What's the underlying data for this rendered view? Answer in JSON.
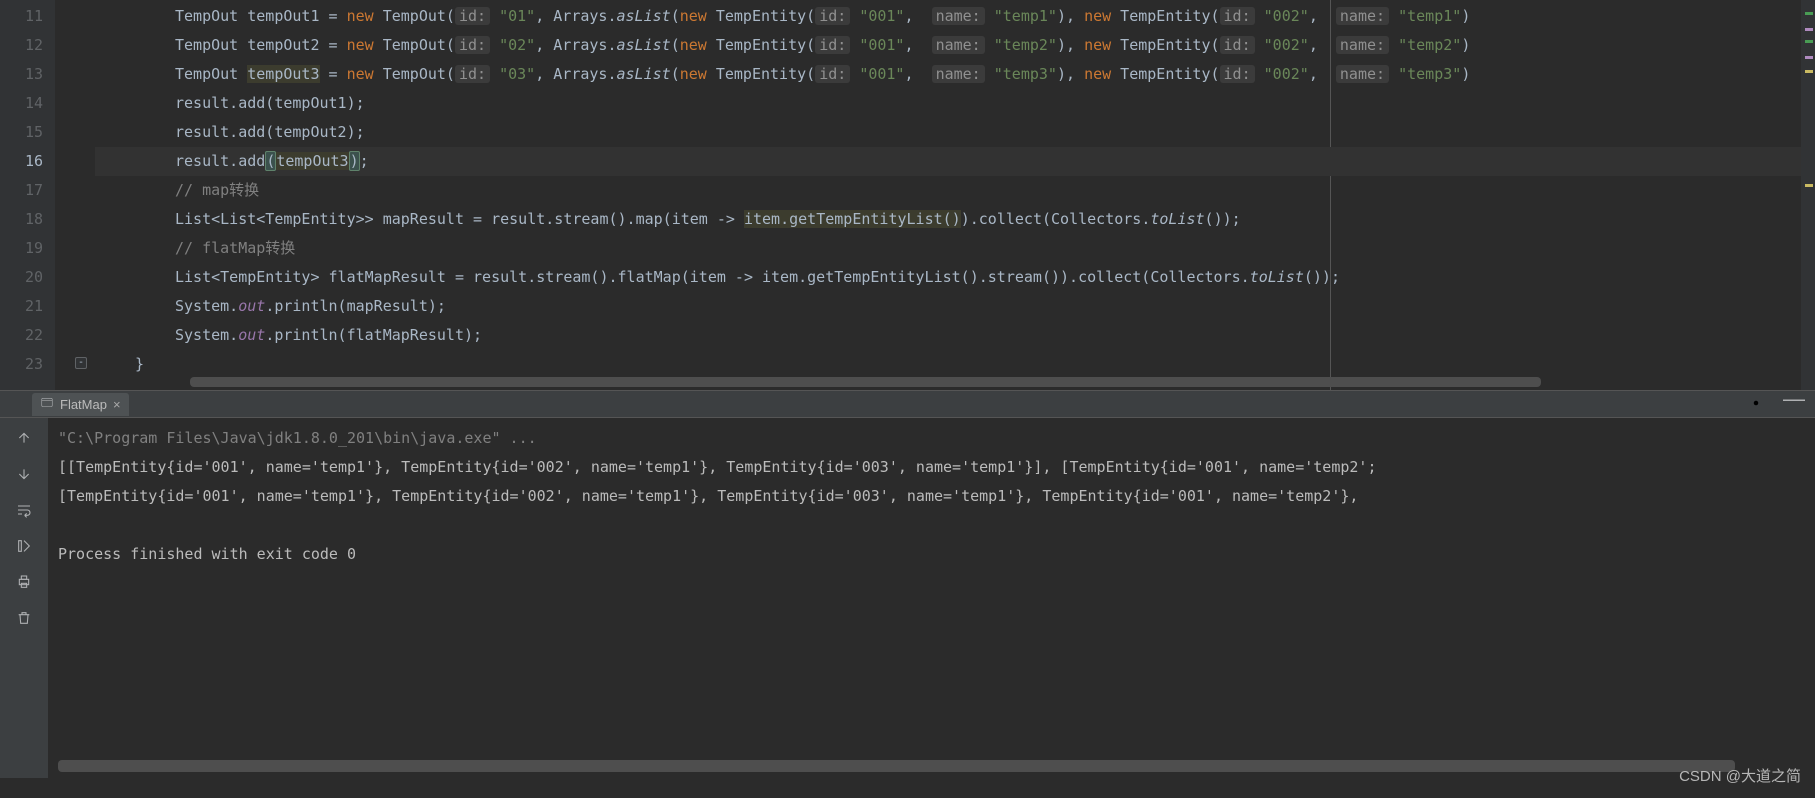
{
  "gutter": [
    "11",
    "12",
    "13",
    "14",
    "15",
    "16",
    "17",
    "18",
    "19",
    "20",
    "21",
    "22",
    "23"
  ],
  "current_line": "16",
  "code": {
    "l11": {
      "a": "TempOut tempOut1 = ",
      "kw": "new",
      "b": " TempOut(",
      "h1": "id:",
      "s1": "\"01\"",
      "c": ", Arrays.",
      "m1": "asList",
      "d": "(",
      "kw2": "new",
      "e": " TempEntity(",
      "h2": "id:",
      "s2": "\"001\"",
      "f": ",",
      "h3": "name:",
      "s3": "\"temp1\"",
      "g": "), ",
      "kw3": "new",
      "hh": " TempEntity(",
      "h4": "id:",
      "s4": "\"002\"",
      "i": ",",
      "h5": "name:",
      "s5": "\"temp1\"",
      "j": ")"
    },
    "l12": {
      "a": "TempOut tempOut2 = ",
      "kw": "new",
      "b": " TempOut(",
      "h1": "id:",
      "s1": "\"02\"",
      "c": ", Arrays.",
      "m1": "asList",
      "d": "(",
      "kw2": "new",
      "e": " TempEntity(",
      "h2": "id:",
      "s2": "\"001\"",
      "f": ",",
      "h3": "name:",
      "s3": "\"temp2\"",
      "g": "), ",
      "kw3": "new",
      "hh": " TempEntity(",
      "h4": "id:",
      "s4": "\"002\"",
      "i": ",",
      "h5": "name:",
      "s5": "\"temp2\"",
      "j": ")"
    },
    "l13": {
      "a": "TempOut ",
      "sel": "tempOut3",
      "a2": " = ",
      "kw": "new",
      "b": " TempOut(",
      "h1": "id:",
      "s1": "\"03\"",
      "c": ", Arrays.",
      "m1": "asList",
      "d": "(",
      "kw2": "new",
      "e": " TempEntity(",
      "h2": "id:",
      "s2": "\"001\"",
      "f": ",",
      "h3": "name:",
      "s3": "\"temp3\"",
      "g": "), ",
      "kw3": "new",
      "hh": " TempEntity(",
      "h4": "id:",
      "s4": "\"002\"",
      "i": ",",
      "h5": "name:",
      "s5": "\"temp3\"",
      "j": ")"
    },
    "l14": "result.add(tempOut1);",
    "l15": "result.add(tempOut2);",
    "l16": {
      "a": "result.add",
      "p1": "(",
      "sel": "tempOut3",
      "p2": ")",
      "b": ";"
    },
    "l17": "// map转换",
    "l18": {
      "a": "List<List<TempEntity>> mapResult = result.stream().map(item -> ",
      "sel": "item.getTempEntityList()",
      "b": ").collect(Collectors.",
      "m": "toList",
      "c": "());"
    },
    "l19": "// flatMap转换",
    "l20": {
      "a": "List<TempEntity> flatMapResult = result.stream().flatMap(item -> item.getTempEntityList().stream()).collect(Collectors.",
      "m": "toList",
      "b": "());"
    },
    "l21": {
      "a": "System.",
      "o": "out",
      "b": ".println(mapResult);"
    },
    "l22": {
      "a": "System.",
      "o": "out",
      "b": ".println(flatMapResult);"
    },
    "l23": "}"
  },
  "run": {
    "tab": "FlatMap",
    "cmd": "\"C:\\Program Files\\Java\\jdk1.8.0_201\\bin\\java.exe\" ...",
    "out1": "[[TempEntity{id='001', name='temp1'}, TempEntity{id='002', name='temp1'}, TempEntity{id='003', name='temp1'}], [TempEntity{id='001', name='temp2';",
    "out2": "[TempEntity{id='001', name='temp1'}, TempEntity{id='002', name='temp1'}, TempEntity{id='003', name='temp1'}, TempEntity{id='001', name='temp2'}, ",
    "exit": "Process finished with exit code 0"
  },
  "watermark": "CSDN @大道之简"
}
